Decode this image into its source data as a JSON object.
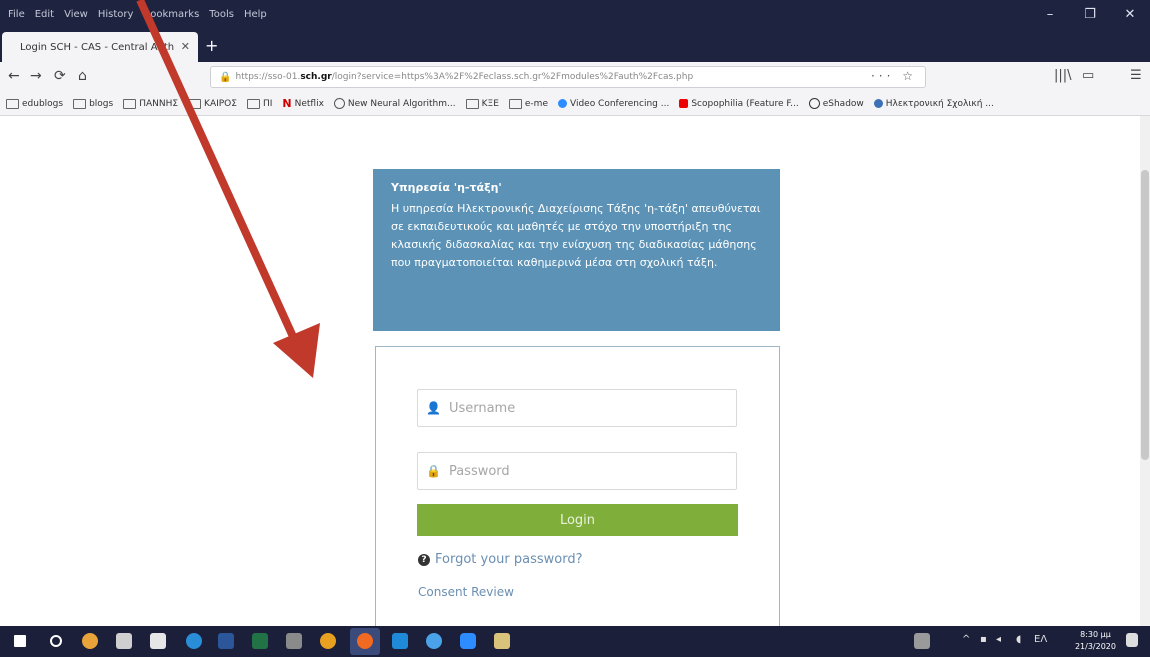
{
  "menu": [
    "File",
    "Edit",
    "View",
    "History",
    "Bookmarks",
    "Tools",
    "Help"
  ],
  "window_controls": {
    "minimize": "–",
    "maximize": "❐",
    "close": "✕"
  },
  "tab": {
    "title": "Login SCH - CAS - Central Auth",
    "close": "✕",
    "new_tab": "+"
  },
  "nav": {
    "back": "←",
    "forward": "→",
    "reload": "⟳",
    "home": "⌂",
    "url_prefix": "https://sso-01.",
    "url_domain": "sch.gr",
    "url_rest": "/login?service=https%3A%2F%2Feclass.sch.gr%2Fmodules%2Fauth%2Fcas.php",
    "url_actions": "··· ☆",
    "right_icons": [
      "|||\\",
      "▭",
      "☰"
    ]
  },
  "bookmarks": [
    {
      "label": "edublogs",
      "kind": "folder"
    },
    {
      "label": "blogs",
      "kind": "folder"
    },
    {
      "label": "ΠΑΝΝΗΣ",
      "kind": "folder"
    },
    {
      "label": "ΚΑΙΡΟΣ",
      "kind": "folder"
    },
    {
      "label": "ΠΙ",
      "kind": "folder"
    },
    {
      "label": "Netflix",
      "kind": "netflix"
    },
    {
      "label": "New Neural Algorithm...",
      "kind": "site"
    },
    {
      "label": "ΚΞΕ",
      "kind": "folder"
    },
    {
      "label": "e-me",
      "kind": "folder"
    },
    {
      "label": "Video Conferencing ...",
      "kind": "video"
    },
    {
      "label": "Scopophilia (Feature F...",
      "kind": "youtube"
    },
    {
      "label": "eShadow",
      "kind": "site"
    },
    {
      "label": "Ηλεκτρονική Σχολική ...",
      "kind": "site"
    }
  ],
  "info": {
    "title": "Υπηρεσία 'η-τάξη'",
    "text": "Η υπηρεσία Ηλεκτρονικής Διαχείρισης Τάξης 'η-τάξη' απευθύνεται σε εκπαιδευτικούς και μαθητές με στόχο την υποστήριξη της κλασικής διδασκαλίας και την ενίσχυση της διαδικασίας μάθησης που πραγματοποιείται καθημερινά μέσα στη σχολική τάξη."
  },
  "login": {
    "username_placeholder": "Username",
    "password_placeholder": "Password",
    "login_label": "Login",
    "forgot_label": "Forgot your password?",
    "consent_label": "Consent Review"
  },
  "taskbar": {
    "time": "8:30 μμ",
    "date": "21/3/2020",
    "lang": "ΕΛ"
  },
  "colors": {
    "info_bg": "#5b92b6",
    "login_button": "#7fae3a",
    "arrow": "#c0392b",
    "link": "#6b8fb2"
  }
}
